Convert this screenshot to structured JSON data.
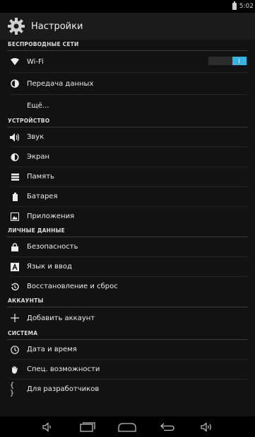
{
  "status_bar": {
    "time": "5:02"
  },
  "header": {
    "title": "Настройки",
    "icon": "gear-icon"
  },
  "sections": {
    "wireless": "БЕСПРОВОДНЫЕ СЕТИ",
    "device": "УСТРОЙСТВО",
    "personal": "ЛИЧНЫЕ ДАННЫЕ",
    "accounts": "АККАУНТЫ",
    "system": "СИСТЕМА"
  },
  "items": {
    "wifi": "Wi-Fi",
    "data_usage": "Передача данных",
    "more": "Ещё...",
    "sound": "Звук",
    "display": "Экран",
    "storage": "Память",
    "battery": "Батарея",
    "apps": "Приложения",
    "security": "Безопасность",
    "language": "Язык и ввод",
    "backup": "Восстановление и сброс",
    "add_account": "Добавить аккаунт",
    "datetime": "Дата и время",
    "accessibility": "Спец. возможности",
    "developer": "Для разработчиков"
  },
  "wifi_toggle": {
    "state": "on"
  },
  "colors": {
    "accent": "#33b5e5",
    "header_bg": "#1b1b1b",
    "list_bg": "#121212"
  }
}
